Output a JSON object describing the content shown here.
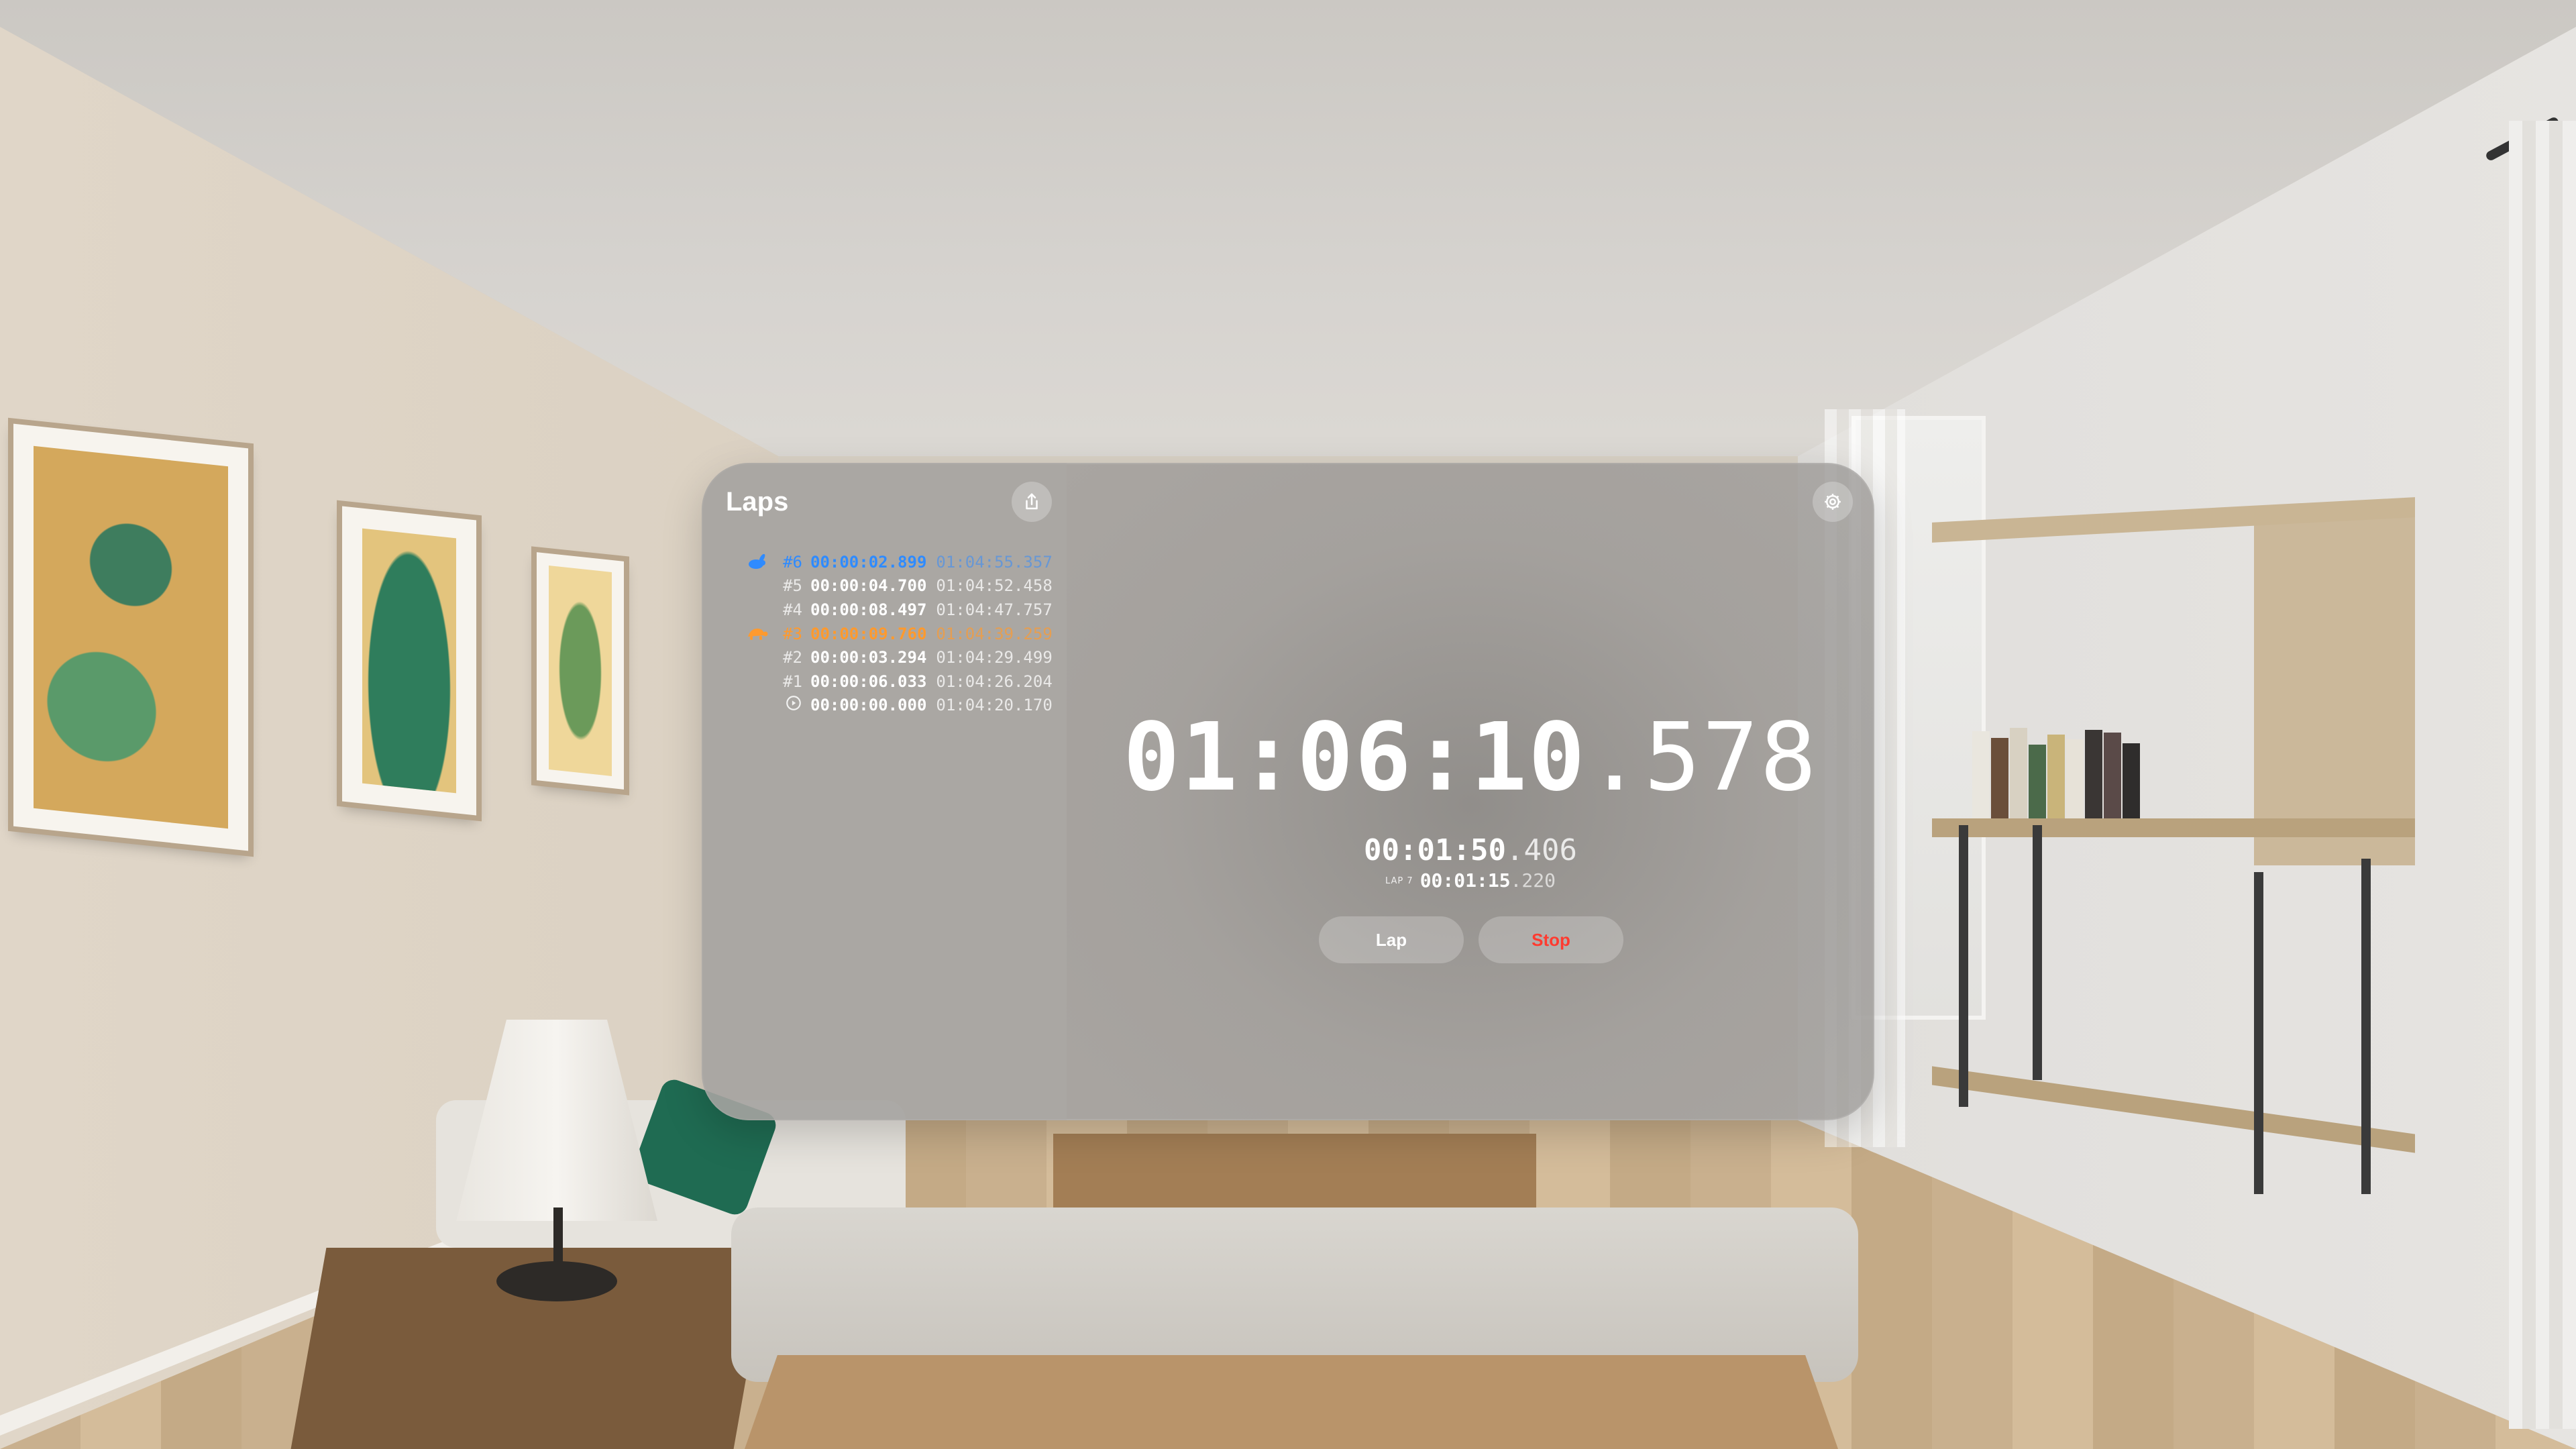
{
  "colors": {
    "fastest_lap": "#2f8bff",
    "slowest_lap": "#ff9a2e",
    "stop": "#ff3b30",
    "text": "#ffffff"
  },
  "laps_panel": {
    "title": "Laps",
    "share_icon": "share-icon",
    "laps": [
      {
        "number": "#6",
        "split": "00:00:02.899",
        "total": "01:04:55.357",
        "badge": "rabbit-icon",
        "type": "fastest"
      },
      {
        "number": "#5",
        "split": "00:00:04.700",
        "total": "01:04:52.458",
        "badge": "",
        "type": "normal"
      },
      {
        "number": "#4",
        "split": "00:00:08.497",
        "total": "01:04:47.757",
        "badge": "",
        "type": "normal"
      },
      {
        "number": "#3",
        "split": "00:00:09.760",
        "total": "01:04:39.259",
        "badge": "turtle-icon",
        "type": "slowest"
      },
      {
        "number": "#2",
        "split": "00:00:03.294",
        "total": "01:04:29.499",
        "badge": "",
        "type": "normal"
      },
      {
        "number": "#1",
        "split": "00:00:06.033",
        "total": "01:04:26.204",
        "badge": "",
        "type": "normal"
      },
      {
        "number": "",
        "split": "00:00:00.000",
        "total": "01:04:20.170",
        "badge": "play-circle-icon",
        "type": "start"
      }
    ]
  },
  "timer": {
    "main": "01:06:10",
    "fraction": ".578",
    "secondary_main": "00:01:50",
    "secondary_fraction": ".406",
    "lap_label": "LAP 7",
    "lap_main": "00:01:15",
    "lap_fraction": ".220"
  },
  "controls": {
    "lap_label": "Lap",
    "stop_label": "Stop",
    "settings_icon": "gear-icon"
  }
}
